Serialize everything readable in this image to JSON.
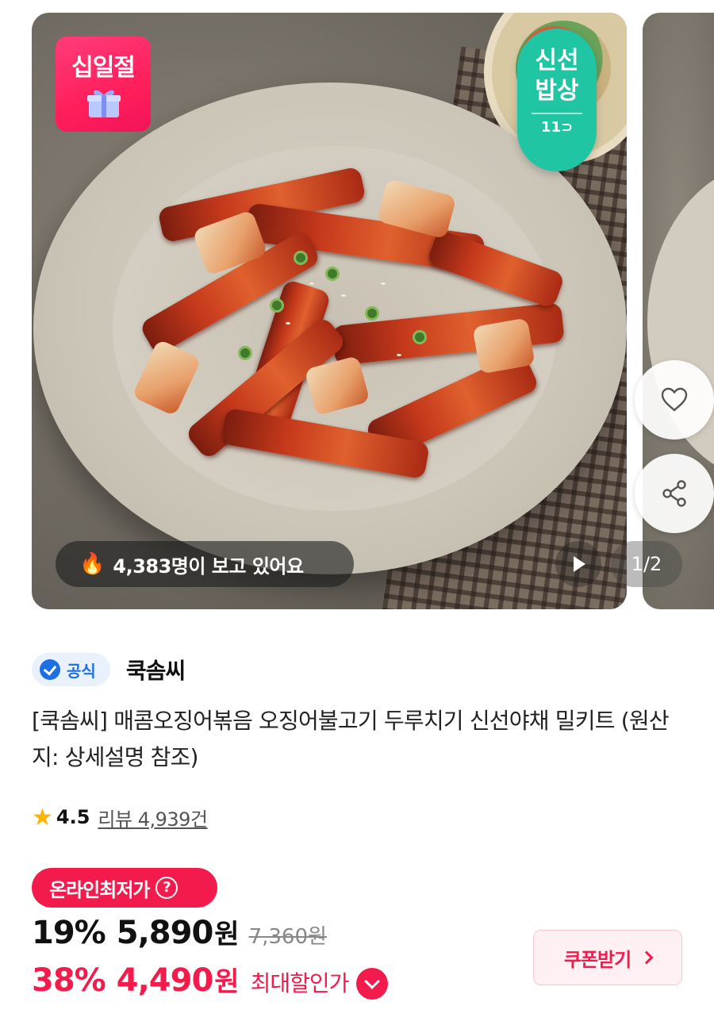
{
  "carousel": {
    "sale_badge": "십일절",
    "fresh_badge": {
      "line1": "신선",
      "line2": "밥상",
      "mark": "11⊃"
    },
    "viewers_text": "4,383명이 보고 있어요",
    "pager": "1/2"
  },
  "seller": {
    "official_label": "공식",
    "name": "쿡솜씨"
  },
  "product": {
    "title": "[쿡솜씨] 매콤오징어볶음 오징어불고기 두루치기 신선야채 밀키트 (원산지: 상세설명 참조)"
  },
  "rating": {
    "score": "4.5",
    "review_text": "리뷰 4,939건"
  },
  "price": {
    "lowest_badge": "온라인최저가",
    "help_icon": "?",
    "discount1": "19%",
    "price1": "5,890",
    "won1": "원",
    "original": "7,360원",
    "discount2": "38%",
    "price2": "4,490",
    "won2": "원",
    "max_label": "최대할인가"
  },
  "coupon": {
    "label": "쿠폰받기"
  },
  "colors": {
    "accent": "#f21b4c",
    "fresh": "#20c5a3",
    "official": "#1e6fe6",
    "star": "#ffb400"
  }
}
